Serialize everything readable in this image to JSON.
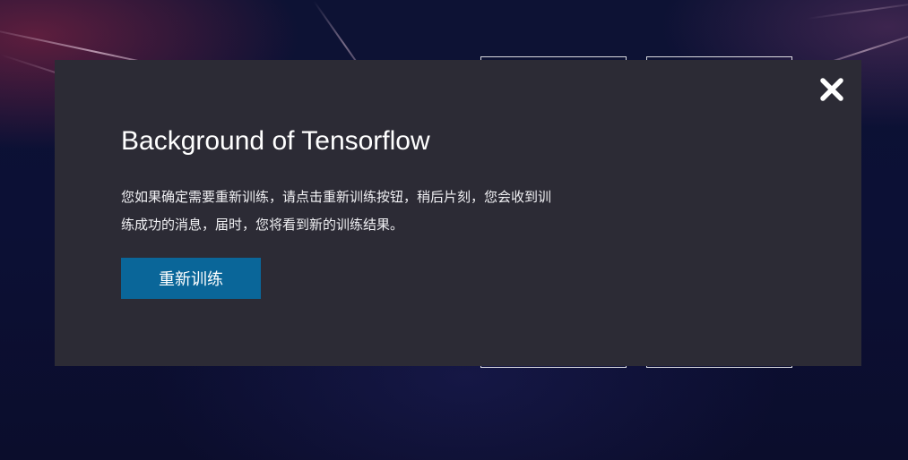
{
  "modal": {
    "title": "Background of Tensorflow",
    "message": "您如果确定需要重新训练，请点击重新训练按钮，稍后片刻，您会收到训练成功的消息，届时，您将看到新的训练结果。",
    "retrain_button_label": "重新训练",
    "close_icon": "close-icon"
  },
  "colors": {
    "modal_background": "#2c2b35",
    "button_background": "#0a6699",
    "text": "#ffffff"
  }
}
